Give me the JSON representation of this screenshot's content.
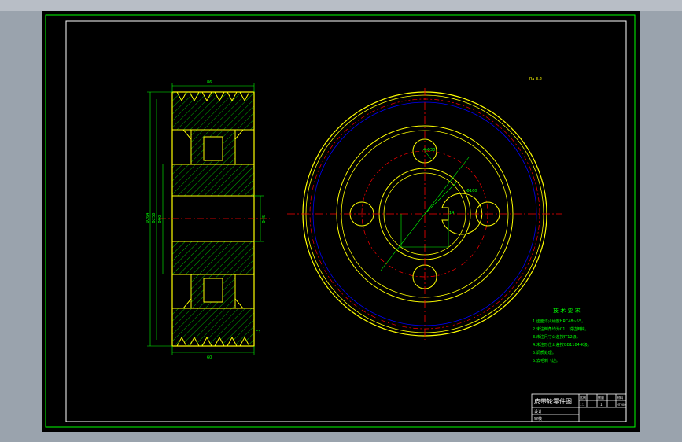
{
  "drawing": {
    "roughness_note": "Ra 3.2",
    "tech_req_title": "技 术 要 求",
    "tech_req_lines": [
      "1.齿面淬火硬度HRC48~55。",
      "2.未注倒角均为C1，锐边倒钝。",
      "3.未注尺寸公差按IT12级。",
      "4.未注形位公差按GB1184-K级。",
      "5.调质处理。",
      "6.去毛刺飞边。"
    ],
    "title_block": {
      "name": "皮带轮零件图",
      "row2": "设计",
      "row3": "审核",
      "scale_label": "比例",
      "scale_value": "1:1",
      "qty_label": "数量",
      "qty_value": "1",
      "material_label": "材料",
      "material_value": "HT200"
    },
    "dims": {
      "od1": "Φ264",
      "od2": "Φ250",
      "bore": "Φ45",
      "hub": "Φ90",
      "keyway": "14",
      "pcd": "Φ160",
      "hole": "4-Φ30",
      "groove_w": "60",
      "face_w": "86",
      "chamfer": "C1"
    }
  },
  "colors": {
    "border": "#00ff00",
    "outline": "#ffff00",
    "center": "#ff0000",
    "hidden": "#0000ff",
    "dim": "#00ff00"
  }
}
